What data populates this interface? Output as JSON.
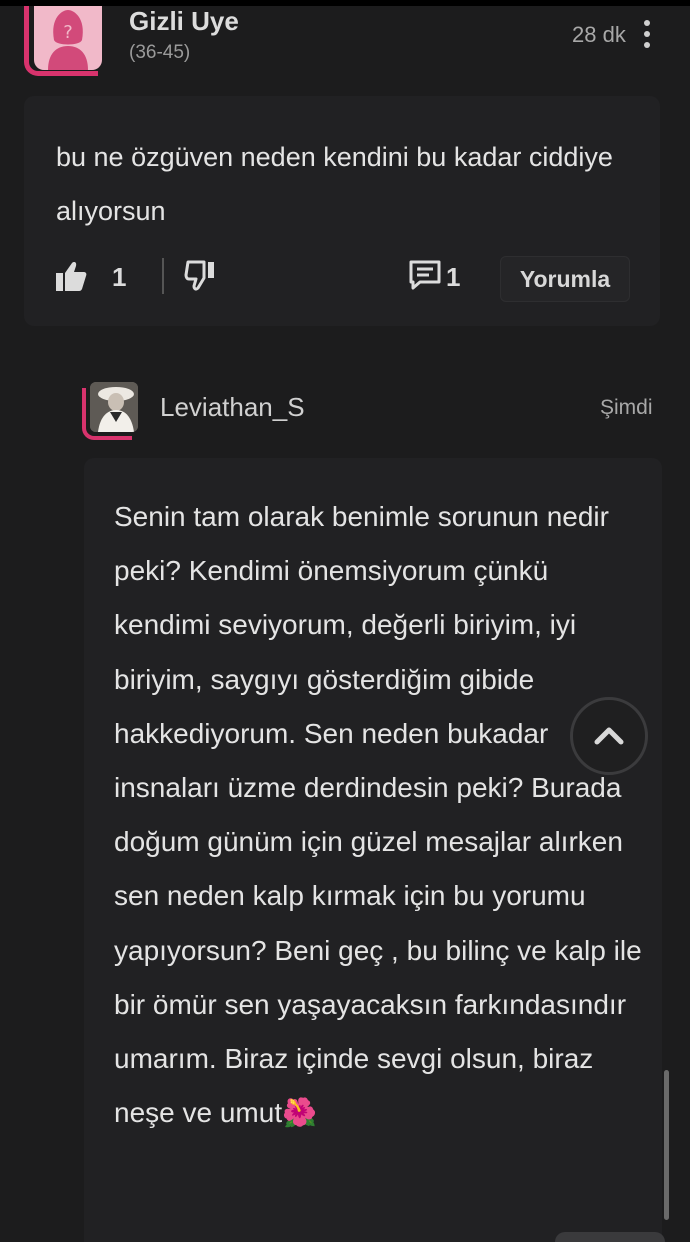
{
  "comment": {
    "author": "Gizli Uye",
    "age_group": "(36-45)",
    "time": "28 dk",
    "text": "bu ne özgüven neden kendini bu kadar ciddiye alıyorsun",
    "likes": "1",
    "replies": "1",
    "reply_button": "Yorumla",
    "accent_color": "#d8336d"
  },
  "reply": {
    "author": "Leviathan_S",
    "time": "Şimdi",
    "text": "Senin tam olarak benimle sorunun nedir peki? Kendimi önemsiyorum çünkü kendimi seviyorum, değerli biriyim, iyi biriyim, saygıyı gösterdiğim gibide hakkediyorum. Sen neden bukadar insnaları üzme derdindesin peki? Burada doğum günüm için güzel mesajlar alırken sen neden kalp kırmak için bu yorumu yapıyorsun? Beni geç , bu bilinç ve kalp ile bir ömür sen yaşayacaksın farkındasındır umarım. Biraz içinde sevgi olsun, biraz neşe ve umut",
    "emoji": "🌺"
  },
  "icons": {
    "menu": "more-vertical-icon",
    "like": "thumbs-up-icon",
    "dislike": "thumbs-down-icon",
    "reply": "comment-icon",
    "scroll_top": "chevron-up-icon"
  }
}
